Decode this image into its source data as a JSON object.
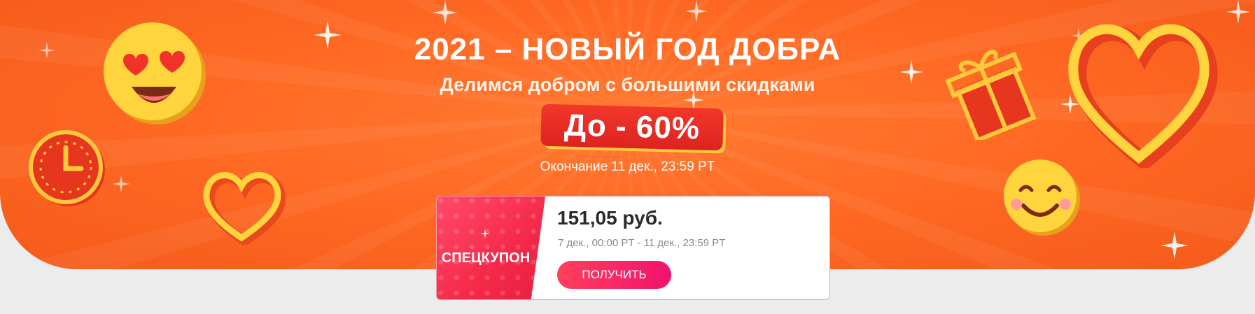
{
  "banner": {
    "title": "2021 – НОВЫЙ ГОД ДОБРА",
    "subtitle": "Делимся добром с большими скидками",
    "discount": "До - 60%",
    "end_date": "Окончание 11 дек., 23:59 PT",
    "colors": {
      "background": "#ff6a24",
      "accent": "#dc2321",
      "gold": "#ffc93c"
    },
    "decor_icons": [
      "heart-eyes-emoji-icon",
      "clock-icon",
      "heart-outline-icon",
      "gift-box-icon",
      "big-heart-icon",
      "smiling-emoji-icon",
      "sparkle-icon"
    ]
  },
  "coupon": {
    "label": "СПЕЦКУПОН",
    "amount": "151,05 руб.",
    "period": "7 дек., 00:00 PT - 11 дек., 23:59 PT",
    "button_label": "ПОЛУЧИТЬ",
    "colors": {
      "label_bg": "#f52a4a",
      "button": "#f2126e"
    }
  }
}
